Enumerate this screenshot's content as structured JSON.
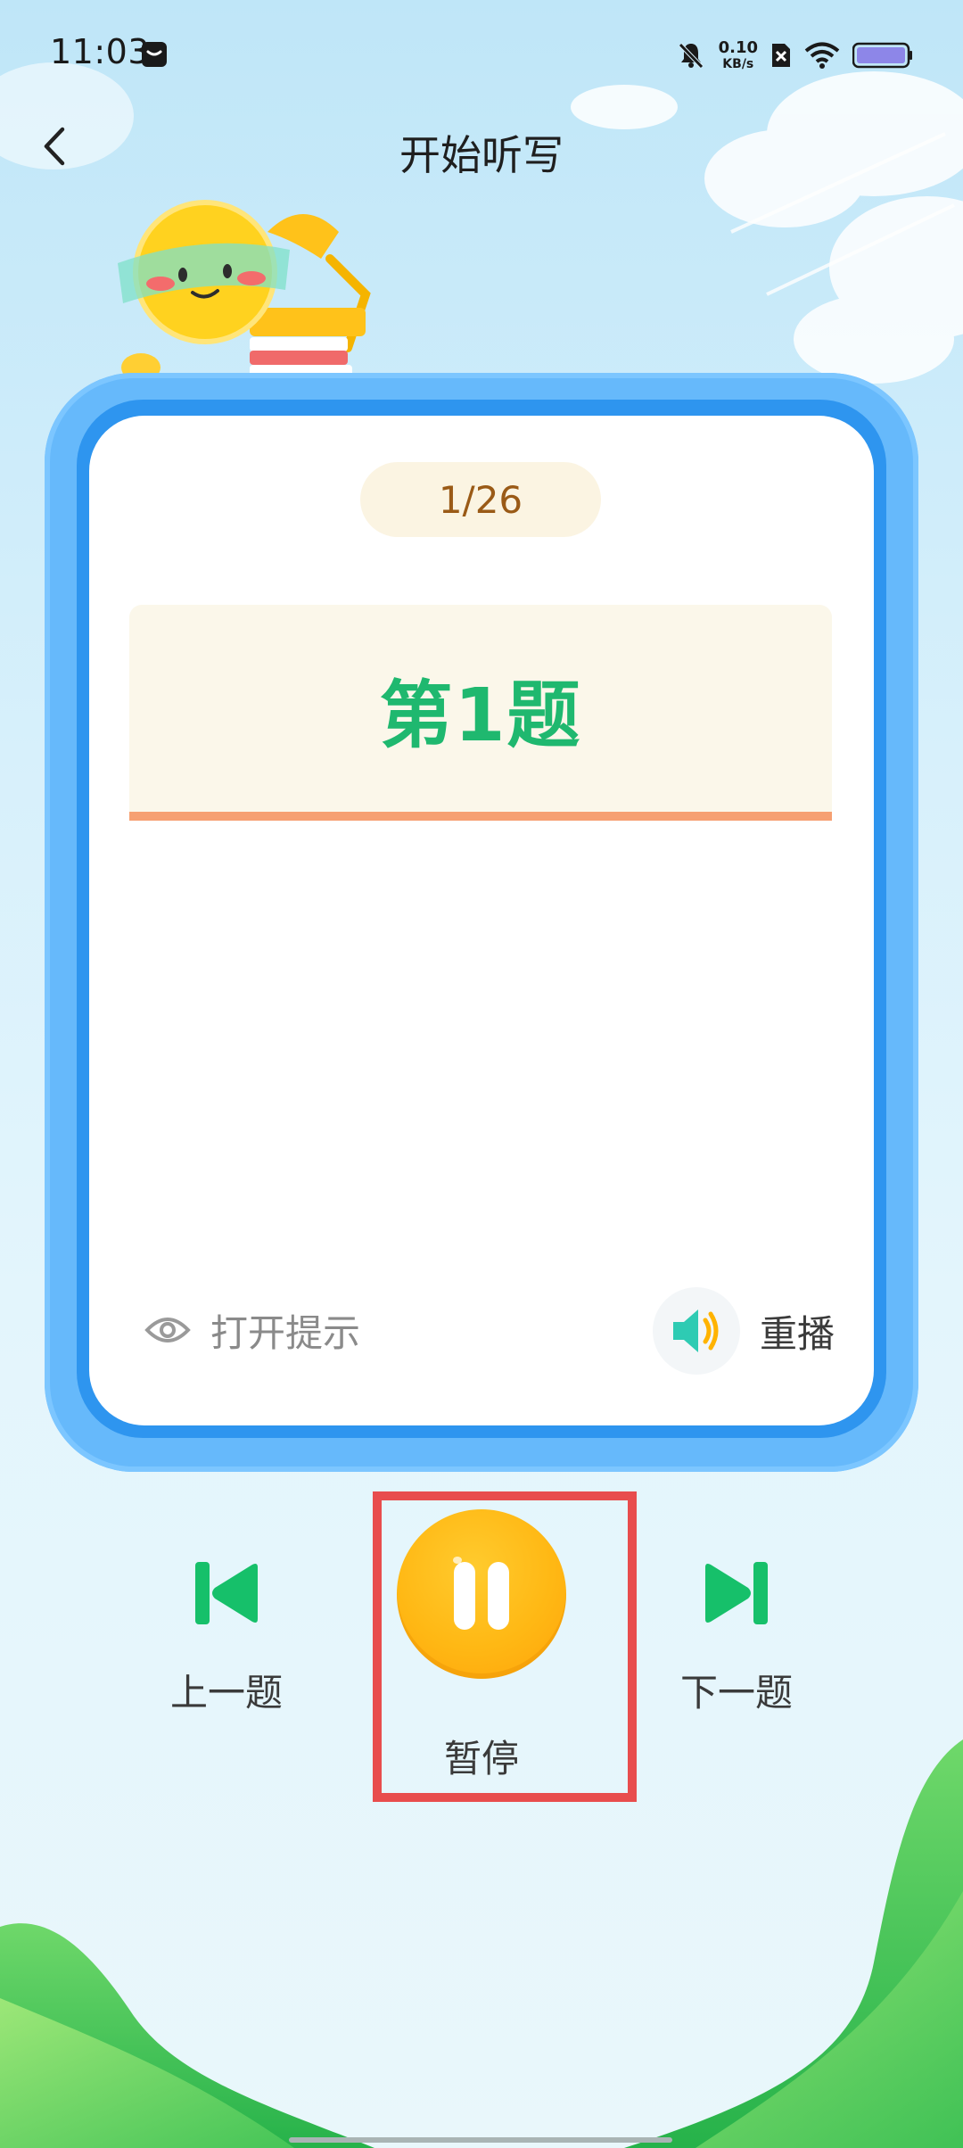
{
  "status_bar": {
    "time": "11:03",
    "net_speed_value": "0.10",
    "net_speed_unit": "KB/s"
  },
  "header": {
    "title": "开始听写"
  },
  "card": {
    "progress": "1/26",
    "question_title": "第1题",
    "hint_label": "打开提示",
    "replay_label": "重播"
  },
  "controls": {
    "prev_label": "上一题",
    "pause_label": "暂停",
    "next_label": "下一题"
  },
  "colors": {
    "accent_green": "#1fb86f",
    "card_frame_blue": "#66b9fb",
    "pause_orange": "#ffb814",
    "underline_orange": "#f6a072",
    "highlight_red": "#e84d4d"
  },
  "icons": {
    "back": "chevron-left-icon",
    "hint": "eye-icon",
    "replay": "speaker-icon",
    "prev": "skip-previous-icon",
    "pause": "pause-icon",
    "next": "skip-next-icon"
  }
}
